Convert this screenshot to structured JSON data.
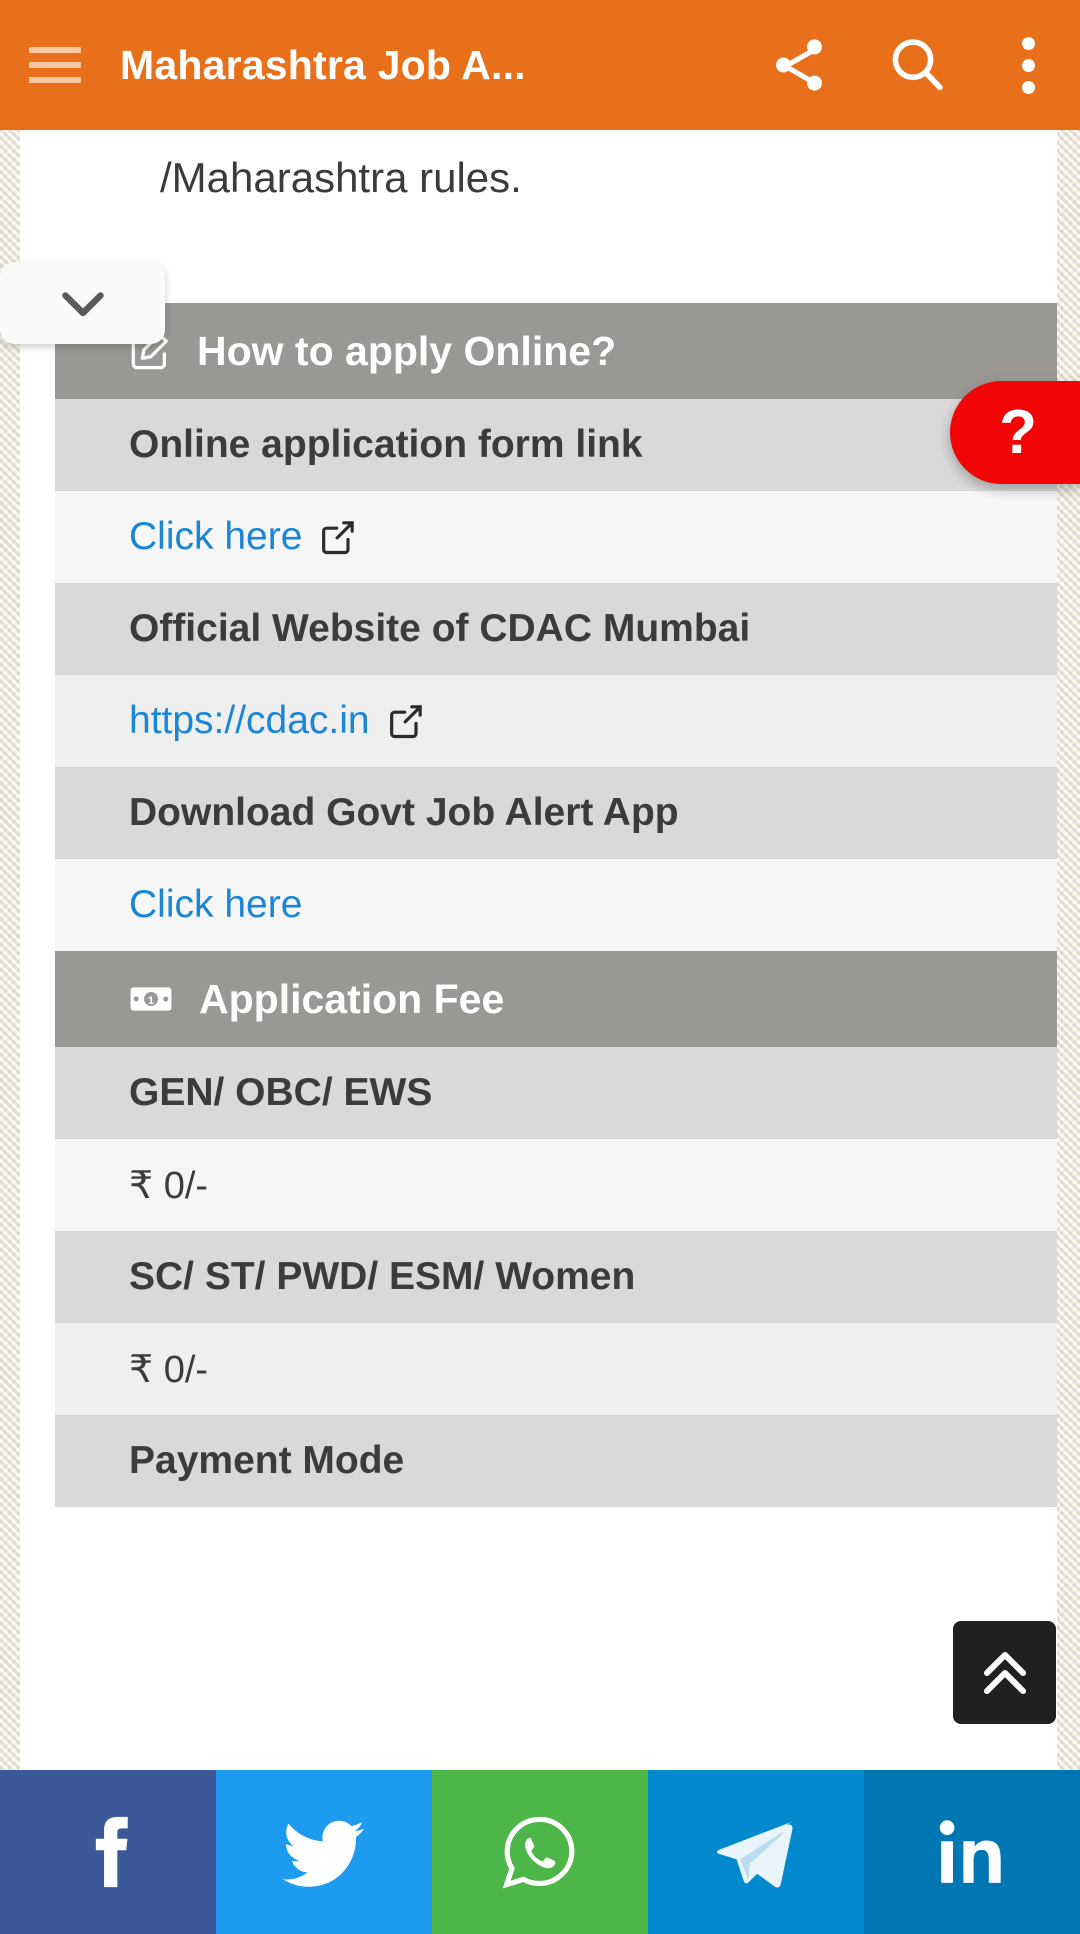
{
  "appbar": {
    "menu_icon": "hamburger-menu-icon",
    "title": "Maharashtra Job A...",
    "share_icon": "share-icon",
    "search_icon": "search-icon",
    "overflow_icon": "more-vertical-icon"
  },
  "content": {
    "lead_text": "/Maharashtra rules.",
    "collapse_icon": "chevron-down-icon"
  },
  "table": {
    "rows": [
      {
        "kind": "head",
        "icon": "pencil-square-icon",
        "text": "How to apply Online?"
      },
      {
        "kind": "label",
        "text": "Online application form link"
      },
      {
        "kind": "link",
        "text": "Click here",
        "external": true
      },
      {
        "kind": "label",
        "text": "Official Website of CDAC Mumbai"
      },
      {
        "kind": "link",
        "text": "https://cdac.in",
        "external": true
      },
      {
        "kind": "label",
        "text": "Download Govt Job Alert App"
      },
      {
        "kind": "link",
        "text": "Click here",
        "external": false
      },
      {
        "kind": "head",
        "icon": "banknote-icon",
        "text": "Application Fee"
      },
      {
        "kind": "label",
        "text": "GEN/ OBC/ EWS"
      },
      {
        "kind": "value",
        "text": "₹ 0/-"
      },
      {
        "kind": "label",
        "text": "SC/ ST/ PWD/ ESM/ Women"
      },
      {
        "kind": "value",
        "text": "₹ 0/-"
      },
      {
        "kind": "label",
        "text": "Payment Mode"
      }
    ]
  },
  "help_tab": {
    "label": "?",
    "color": "#f40505"
  },
  "scroll_top": {
    "icon": "double-chevron-up-icon"
  },
  "social": {
    "items": [
      {
        "name": "facebook",
        "icon": "facebook-icon",
        "color": "#3b5998"
      },
      {
        "name": "twitter",
        "icon": "twitter-icon",
        "color": "#1d9bf0"
      },
      {
        "name": "whatsapp",
        "icon": "whatsapp-icon",
        "color": "#4cb648"
      },
      {
        "name": "telegram",
        "icon": "telegram-icon",
        "color": "#0089cc"
      },
      {
        "name": "linkedin",
        "icon": "linkedin-icon",
        "color": "#0077b5"
      }
    ]
  },
  "colors": {
    "appbar": "#e8701a",
    "head_row": "#9a9894",
    "shade_row": "#d9d9d9",
    "link": "#1b86d6"
  }
}
